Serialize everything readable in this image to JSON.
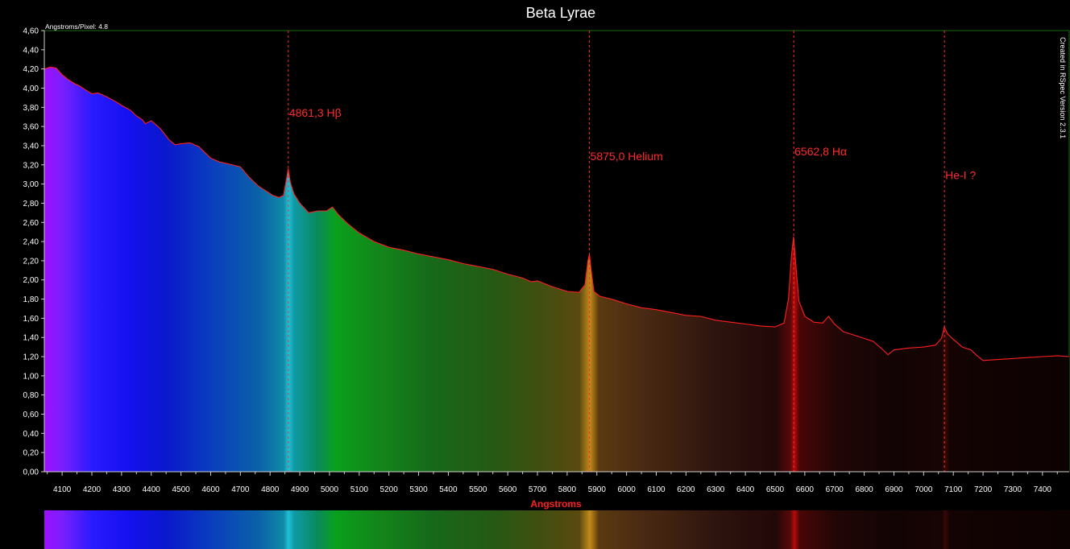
{
  "chart_data": {
    "type": "area",
    "title": "Beta Lyrae",
    "xlabel": "Angstroms",
    "ylabel": "",
    "corner_label": "Angstroms/Pixel: 4.8",
    "credit_label": "Created in RSpec Version 2.3.1",
    "xlim": [
      4040,
      7490
    ],
    "ylim": [
      0.0,
      4.6
    ],
    "x_ticks": [
      "4100",
      "4200",
      "4300",
      "4400",
      "4500",
      "4600",
      "4700",
      "4800",
      "4900",
      "5000",
      "5100",
      "5200",
      "5300",
      "5400",
      "5500",
      "5600",
      "5700",
      "5800",
      "5900",
      "6000",
      "6100",
      "6200",
      "6300",
      "6400",
      "6500",
      "6600",
      "6700",
      "6800",
      "6900",
      "7000",
      "7100",
      "7200",
      "7300",
      "7400"
    ],
    "y_ticks": [
      "0,00",
      "0,20",
      "0,40",
      "0,60",
      "0,80",
      "1,00",
      "1,20",
      "1,40",
      "1,60",
      "1,80",
      "2,00",
      "2,20",
      "2,40",
      "2,60",
      "2,80",
      "3,00",
      "3,20",
      "3,40",
      "3,60",
      "3,80",
      "4,00",
      "4,20",
      "4,40",
      "4,60"
    ],
    "grid": false,
    "series": [
      {
        "x": [
          4040,
          4060,
          4080,
          4100,
          4120,
          4140,
          4160,
          4180,
          4200,
          4220,
          4250,
          4280,
          4300,
          4330,
          4350,
          4370,
          4380,
          4400,
          4430,
          4460,
          4480,
          4500,
          4530,
          4560,
          4580,
          4600,
          4630,
          4660,
          4700,
          4730,
          4760,
          4790,
          4810,
          4830,
          4845,
          4855,
          4861,
          4868,
          4880,
          4900,
          4930,
          4960,
          4990,
          5010,
          5030,
          5060,
          5100,
          5150,
          5200,
          5250,
          5300,
          5350,
          5400,
          5450,
          5500,
          5550,
          5600,
          5650,
          5680,
          5700,
          5750,
          5800,
          5840,
          5860,
          5870,
          5875,
          5880,
          5890,
          5910,
          5950,
          6000,
          6050,
          6100,
          6150,
          6200,
          6250,
          6300,
          6350,
          6400,
          6450,
          6500,
          6530,
          6545,
          6555,
          6562,
          6570,
          6580,
          6600,
          6630,
          6660,
          6680,
          6700,
          6730,
          6760,
          6800,
          6830,
          6860,
          6880,
          6900,
          6950,
          7000,
          7040,
          7060,
          7070,
          7080,
          7100,
          7130,
          7160,
          7180,
          7200,
          7250,
          7300,
          7350,
          7400,
          7450,
          7490
        ],
        "values": [
          4.2,
          4.22,
          4.21,
          4.14,
          4.09,
          4.05,
          4.02,
          3.98,
          3.94,
          3.95,
          3.91,
          3.86,
          3.82,
          3.77,
          3.71,
          3.67,
          3.63,
          3.66,
          3.58,
          3.46,
          3.41,
          3.42,
          3.43,
          3.39,
          3.33,
          3.27,
          3.23,
          3.21,
          3.18,
          3.07,
          2.98,
          2.92,
          2.88,
          2.86,
          2.88,
          3.05,
          3.16,
          3.02,
          2.9,
          2.8,
          2.7,
          2.72,
          2.72,
          2.76,
          2.68,
          2.59,
          2.49,
          2.4,
          2.34,
          2.31,
          2.27,
          2.24,
          2.21,
          2.17,
          2.14,
          2.11,
          2.06,
          2.02,
          1.98,
          1.99,
          1.93,
          1.88,
          1.87,
          1.95,
          2.2,
          2.27,
          2.12,
          1.88,
          1.83,
          1.8,
          1.75,
          1.71,
          1.69,
          1.66,
          1.63,
          1.62,
          1.58,
          1.56,
          1.54,
          1.52,
          1.51,
          1.55,
          1.8,
          2.25,
          2.45,
          2.15,
          1.78,
          1.62,
          1.56,
          1.55,
          1.62,
          1.54,
          1.46,
          1.43,
          1.39,
          1.36,
          1.28,
          1.22,
          1.27,
          1.29,
          1.3,
          1.32,
          1.39,
          1.51,
          1.44,
          1.38,
          1.3,
          1.27,
          1.21,
          1.16,
          1.17,
          1.18,
          1.19,
          1.2,
          1.21,
          1.2
        ]
      }
    ],
    "annotations": [
      {
        "x": 4861.3,
        "label": "4861,3 Hβ",
        "label_y": 3.7
      },
      {
        "x": 5875.0,
        "label": "5875,0 Helium",
        "label_y": 3.25
      },
      {
        "x": 6562.8,
        "label": "6562,8 Hα",
        "label_y": 3.3
      },
      {
        "x": 7070.0,
        "label": "He-I ?",
        "label_y": 3.05
      }
    ],
    "colors": {
      "background": "#000000",
      "curve": "#ff2020",
      "annotation": "#ff2a2a",
      "axis_text": "#ffffff",
      "xlabel": "#ff2020",
      "frame": "#1a6b1a"
    }
  }
}
